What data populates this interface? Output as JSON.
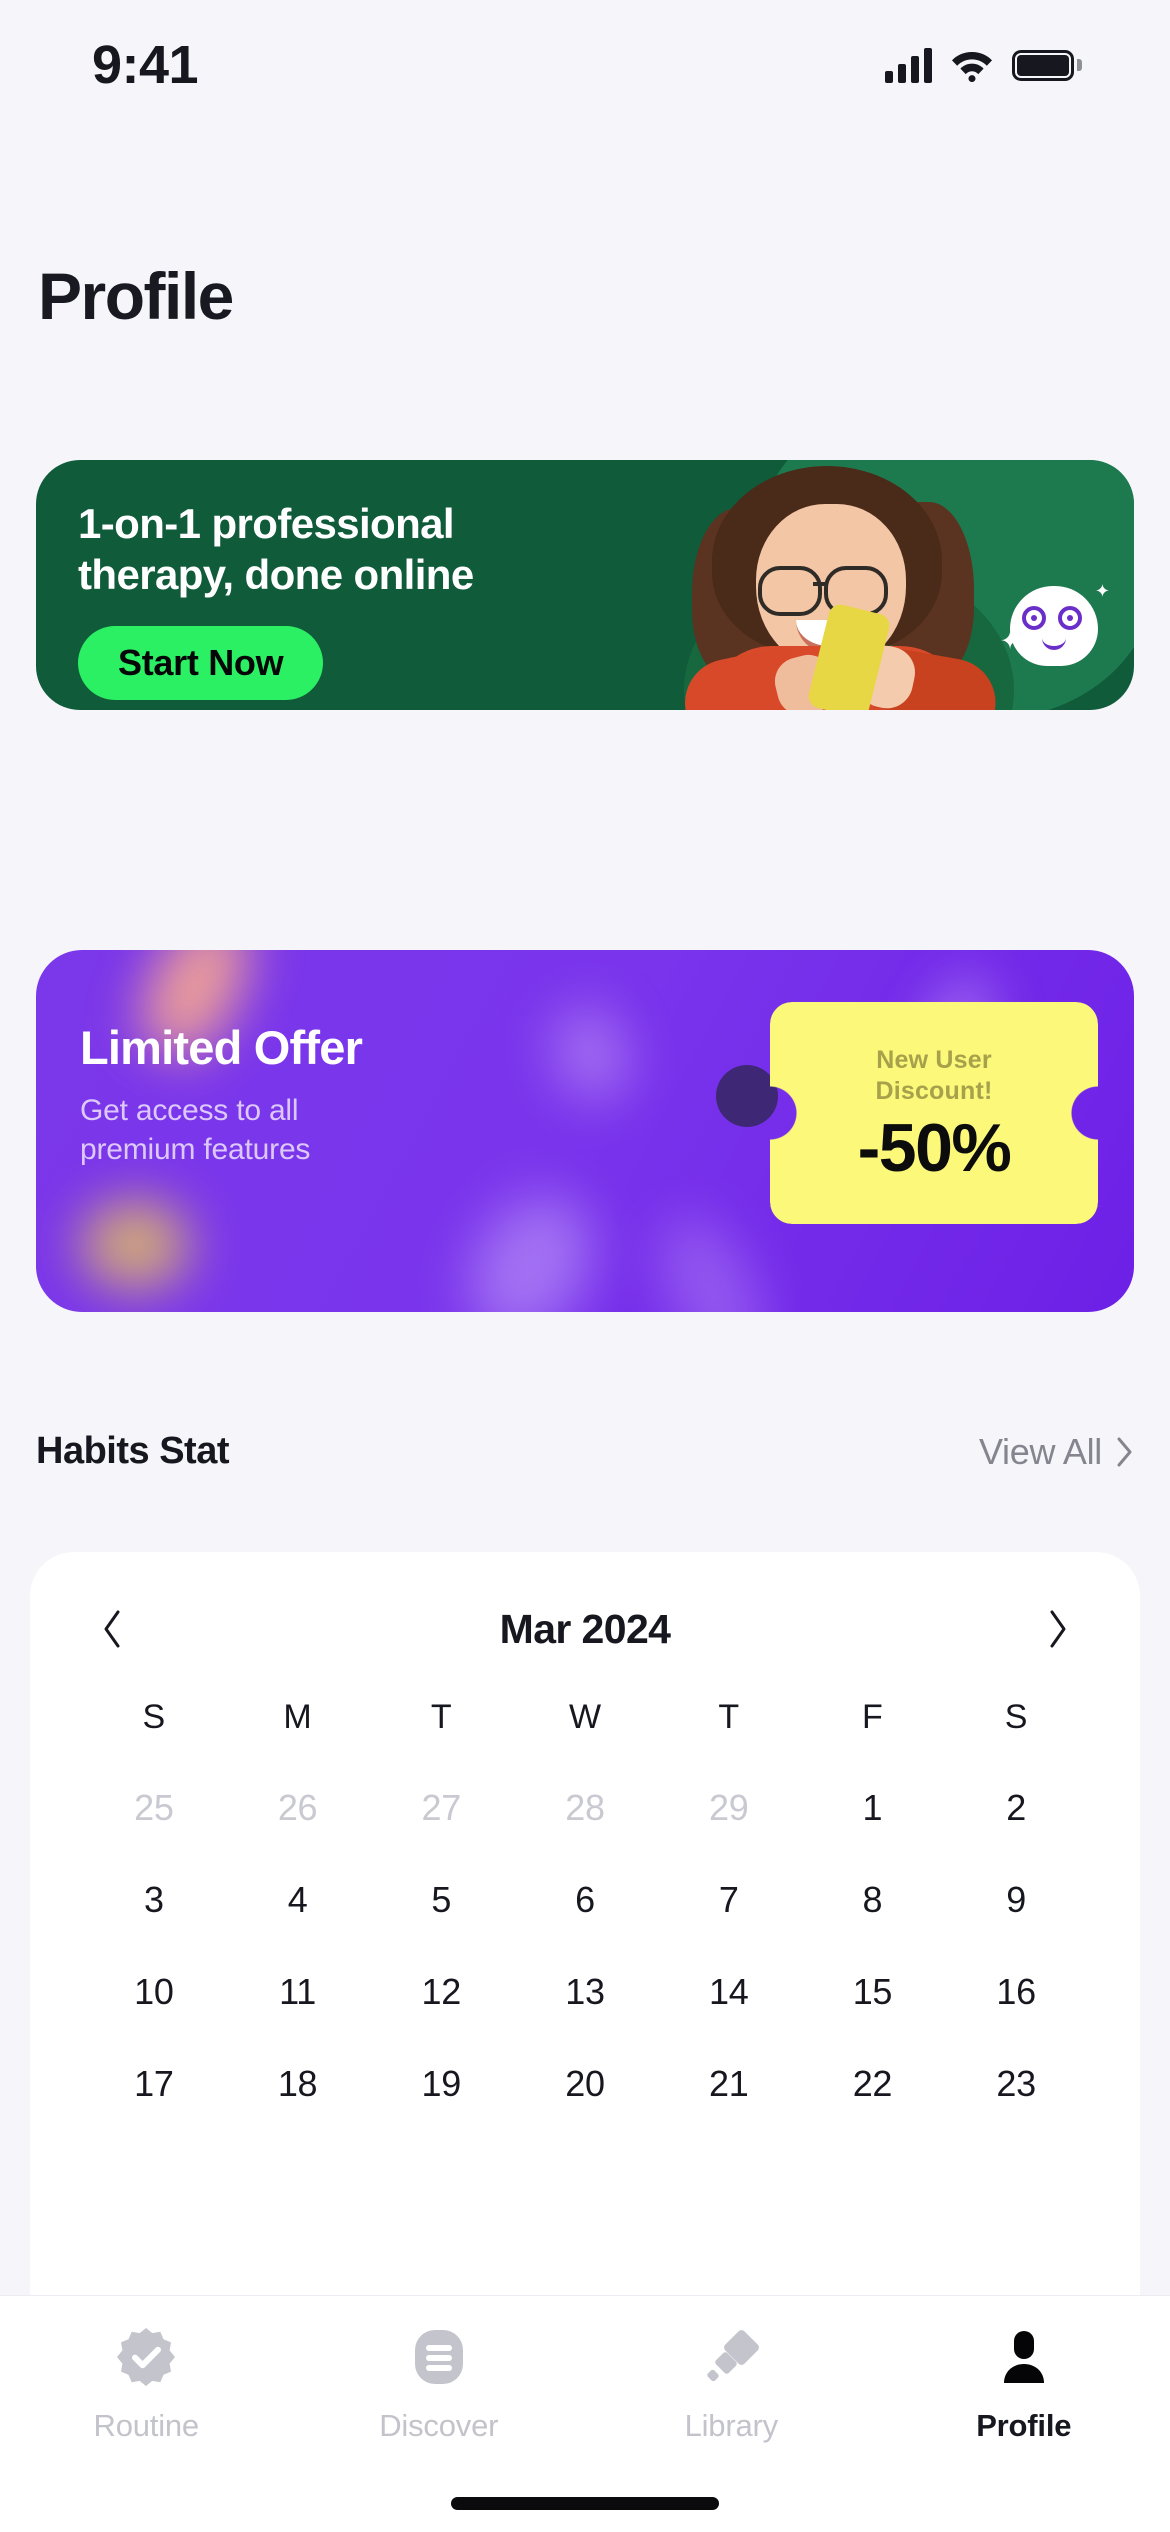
{
  "status_bar": {
    "time": "9:41",
    "icons": [
      "cellular-signal-icon",
      "wifi-icon",
      "battery-icon"
    ]
  },
  "header": {
    "title": "Profile"
  },
  "therapy_banner": {
    "heading": "1-on-1 professional\ntherapy, done online",
    "cta_label": "Start Now",
    "bg_color": "#0f5b3a",
    "cta_color": "#2cf064"
  },
  "offer_card": {
    "title": "Limited Offer",
    "subtitle": "Get access to all\npremium features",
    "coupon_label": "New User\nDiscount!",
    "coupon_value": "-50%",
    "bg_color": "#7b37ea",
    "coupon_color": "#fbf87a"
  },
  "habits_section": {
    "title": "Habits Stat",
    "view_all_label": "View All"
  },
  "calendar": {
    "month_label": "Mar 2024",
    "prev_icon": "chevron-left-icon",
    "next_icon": "chevron-right-icon",
    "weekdays": [
      "S",
      "M",
      "T",
      "W",
      "T",
      "F",
      "S"
    ],
    "rows": [
      [
        {
          "day": "25",
          "muted": true
        },
        {
          "day": "26",
          "muted": true
        },
        {
          "day": "27",
          "muted": true
        },
        {
          "day": "28",
          "muted": true
        },
        {
          "day": "29",
          "muted": true
        },
        {
          "day": "1",
          "muted": false
        },
        {
          "day": "2",
          "muted": false
        }
      ],
      [
        {
          "day": "3",
          "muted": false
        },
        {
          "day": "4",
          "muted": false
        },
        {
          "day": "5",
          "muted": false
        },
        {
          "day": "6",
          "muted": false
        },
        {
          "day": "7",
          "muted": false
        },
        {
          "day": "8",
          "muted": false
        },
        {
          "day": "9",
          "muted": false
        }
      ],
      [
        {
          "day": "10",
          "muted": false
        },
        {
          "day": "11",
          "muted": false
        },
        {
          "day": "12",
          "muted": false
        },
        {
          "day": "13",
          "muted": false
        },
        {
          "day": "14",
          "muted": false
        },
        {
          "day": "15",
          "muted": false
        },
        {
          "day": "16",
          "muted": false
        }
      ],
      [
        {
          "day": "17",
          "muted": false
        },
        {
          "day": "18",
          "muted": false
        },
        {
          "day": "19",
          "muted": false
        },
        {
          "day": "20",
          "muted": false
        },
        {
          "day": "21",
          "muted": false
        },
        {
          "day": "22",
          "muted": false
        },
        {
          "day": "23",
          "muted": false
        }
      ]
    ]
  },
  "tab_bar": {
    "items": [
      {
        "label": "Routine",
        "icon": "verified-check-badge-icon",
        "active": false
      },
      {
        "label": "Discover",
        "icon": "list-lines-icon",
        "active": false
      },
      {
        "label": "Library",
        "icon": "diamond-brush-icon",
        "active": false
      },
      {
        "label": "Profile",
        "icon": "person-icon",
        "active": true
      }
    ]
  }
}
